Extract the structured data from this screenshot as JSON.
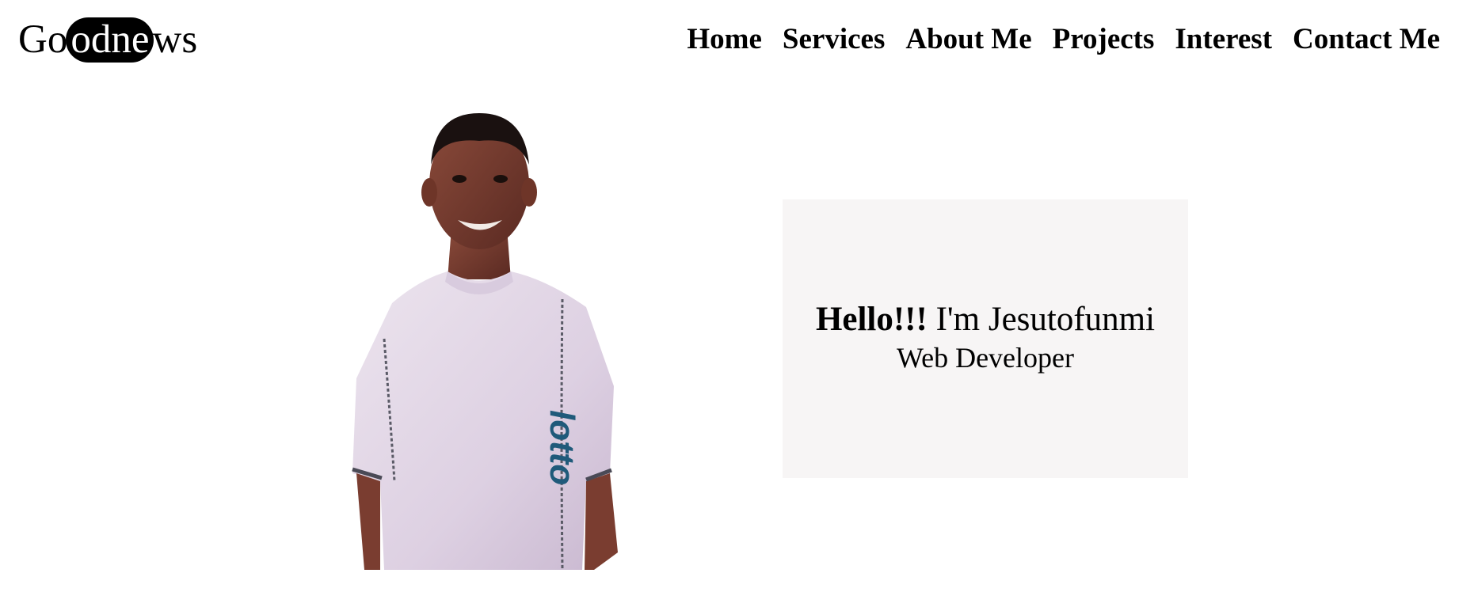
{
  "header": {
    "logo": {
      "prefix": "Go",
      "highlight": "odne",
      "suffix": "ws"
    },
    "nav": [
      {
        "label": "Home"
      },
      {
        "label": "Services"
      },
      {
        "label": "About Me"
      },
      {
        "label": "Projects"
      },
      {
        "label": "Interest"
      },
      {
        "label": "Contact Me"
      }
    ]
  },
  "hero": {
    "greeting": "Hello!!!",
    "intro": "I'm Jesutofunmi",
    "role": "Web Developer",
    "photo_shirt_brand": "lotto"
  },
  "colors": {
    "logo_pill": "#000000",
    "card_background": "#f7f5f5",
    "text": "#000000",
    "page_background": "#ffffff"
  }
}
